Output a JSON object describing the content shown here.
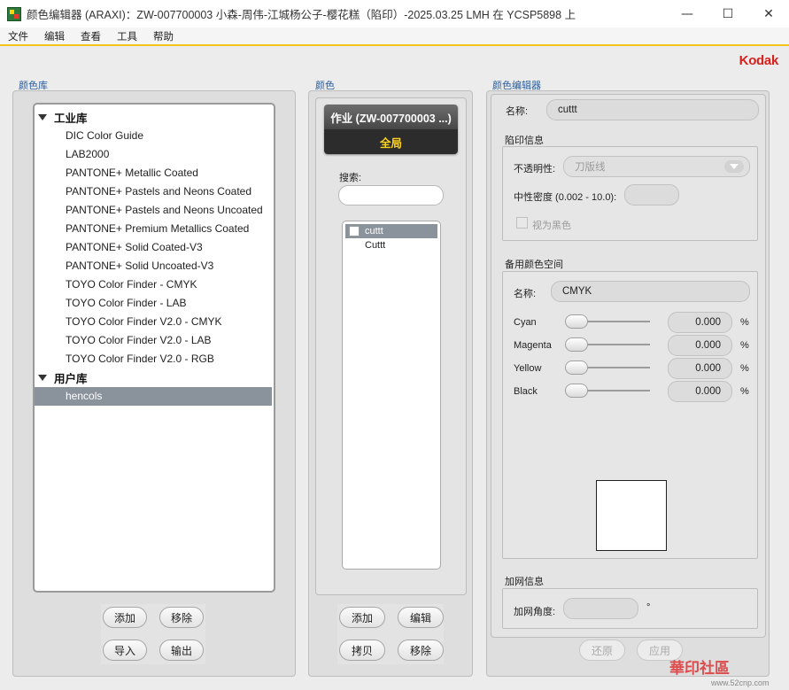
{
  "window": {
    "title": "颜色编辑器 (ARAXI)：ZW-007700003    小森-周伟-江城杨公子-樱花糕（陷印）-2025.03.25  LMH 在 YCSP5898 上",
    "minimize": "—",
    "maximize": "☐",
    "close": "✕"
  },
  "menu": [
    "文件",
    "编辑",
    "查看",
    "工具",
    "帮助"
  ],
  "brand": "Kodak",
  "library": {
    "label": "颜色库",
    "groups": [
      {
        "name": "工业库",
        "items": [
          "DIC Color Guide",
          "LAB2000",
          "PANTONE+ Metallic Coated",
          "PANTONE+ Pastels and Neons Coated",
          "PANTONE+ Pastels and Neons Uncoated",
          "PANTONE+ Premium Metallics Coated",
          "PANTONE+ Solid Coated-V3",
          "PANTONE+ Solid Uncoated-V3",
          "TOYO Color Finder - CMYK",
          "TOYO Color Finder - LAB",
          "TOYO Color Finder V2.0 - CMYK",
          "TOYO Color Finder V2.0 - LAB",
          "TOYO Color Finder V2.0 - RGB"
        ]
      },
      {
        "name": "用户库",
        "items": [
          "hencols"
        ]
      }
    ],
    "selected_item": "hencols",
    "buttons": {
      "add": "添加",
      "remove": "移除",
      "import": "导入",
      "export": "输出"
    }
  },
  "colors": {
    "label": "颜色",
    "job_title": "作业 (ZW-007700003   ...)",
    "job_scope": "全局",
    "search_label": "搜索:",
    "search_value": "",
    "list": [
      {
        "name": "cuttt",
        "selected": true
      },
      {
        "name": "Cuttt",
        "selected": false
      }
    ],
    "buttons": {
      "add": "添加",
      "edit": "编辑",
      "copy": "拷贝",
      "remove": "移除"
    }
  },
  "editor": {
    "label": "颜色编辑器",
    "name_label": "名称:",
    "name_value": "cuttt",
    "trap_section": "陷印信息",
    "opacity_label": "不透明性:",
    "opacity_value": "刀版线",
    "neutral_density_label": "中性密度 (0.002 - 10.0):",
    "neutral_density_value": "",
    "treat_as_black_label": "视为黑色",
    "alt_space_section": "备用颜色空间",
    "alt_name_label": "名称:",
    "alt_name_value": "CMYK",
    "channels": [
      {
        "name": "Cyan",
        "value": "0.000",
        "unit": "%",
        "level": 0
      },
      {
        "name": "Magenta",
        "value": "0.000",
        "unit": "%",
        "level": 0
      },
      {
        "name": "Yellow",
        "value": "0.000",
        "unit": "%",
        "level": 0
      },
      {
        "name": "Black",
        "value": "0.000",
        "unit": "%",
        "level": 0
      }
    ],
    "preview_color": "#ffffff",
    "screen_section": "加网信息",
    "screen_angle_label": "加网角度:",
    "screen_angle_value": "",
    "screen_angle_unit": "°",
    "buttons": {
      "revert": "还原",
      "apply": "应用"
    }
  },
  "watermark": {
    "text": "華印社區",
    "site": "www.52cnp.com"
  },
  "colors_theme": {
    "accent": "#f0c419",
    "selection": "#8a929c",
    "brand": "#d6201b",
    "section_label": "#2a5d9c"
  }
}
